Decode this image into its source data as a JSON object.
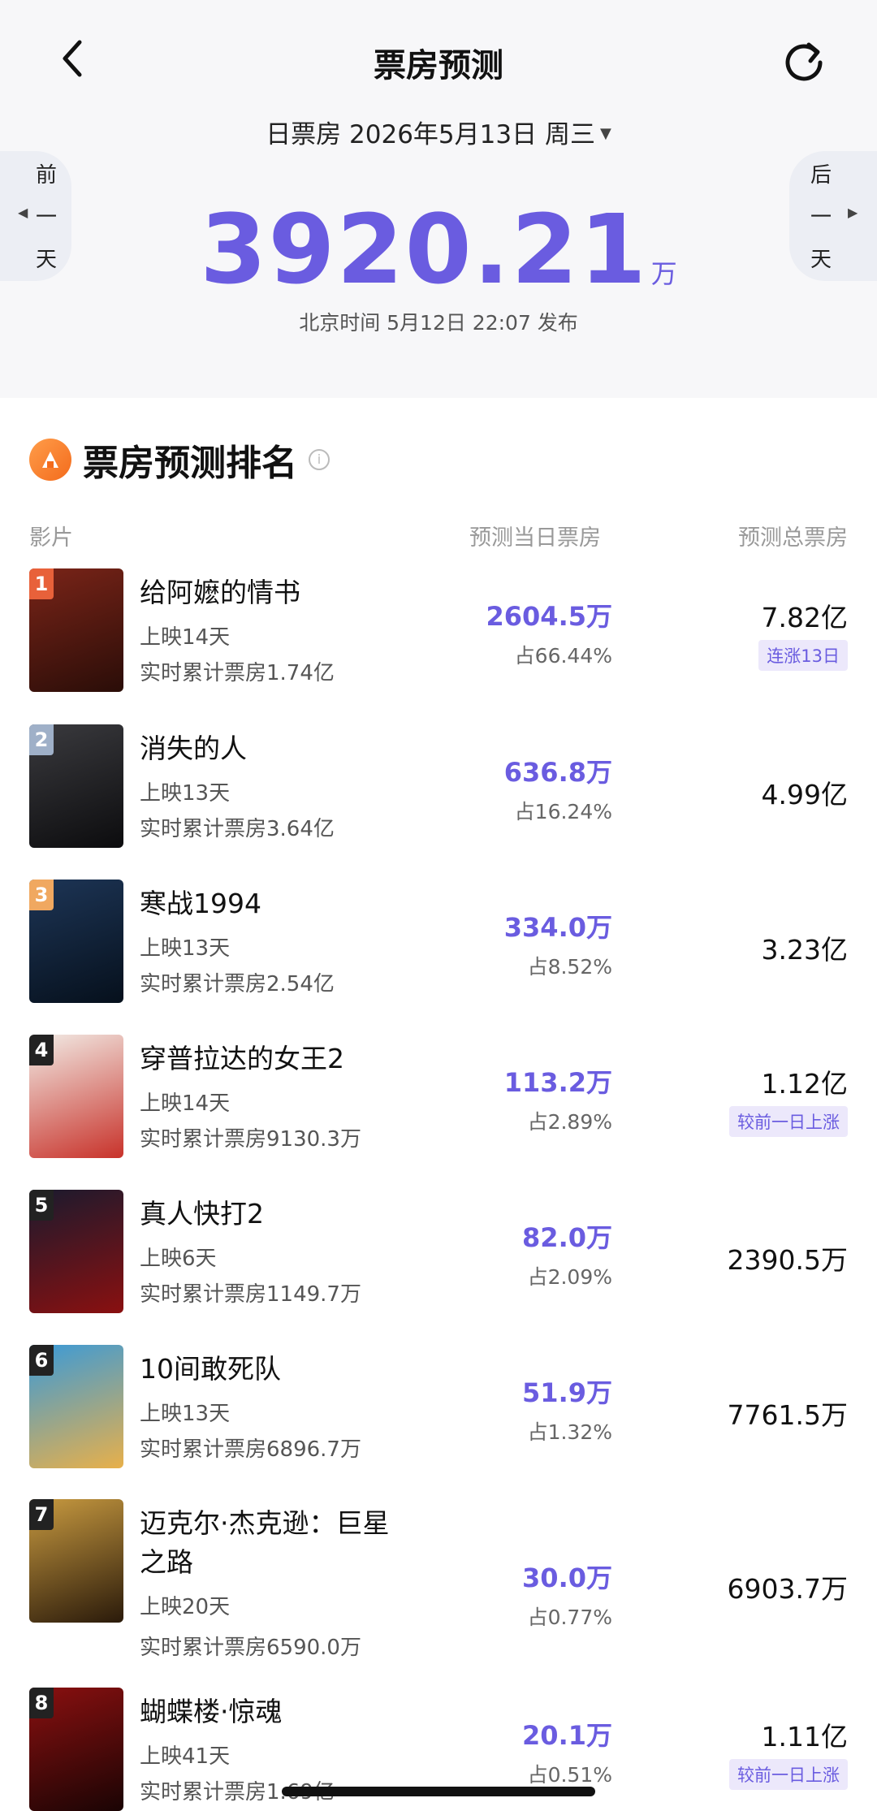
{
  "header": {
    "title": "票房预测",
    "date_label": "日票房 2026年5月13日 周三",
    "prev_label": "前一天",
    "next_label": "后一天",
    "total_value": "3920.21",
    "total_unit": "万",
    "published": "北京时间 5月12日 22:07 发布"
  },
  "section": {
    "title": "票房预测排名",
    "col_film": "影片",
    "col_daily": "预测当日票房",
    "col_total": "预测总票房"
  },
  "movies": [
    {
      "rank": "1",
      "name": "给阿嬷的情书",
      "days": "上映14天",
      "cumulative": "实时累计票房1.74亿",
      "daily": "2604.5万",
      "share": "占66.44%",
      "total": "7.82亿",
      "tag": "连涨13日",
      "rank_color": "#e8613a",
      "poster": [
        "#7a2418",
        "#2a0d08"
      ]
    },
    {
      "rank": "2",
      "name": "消失的人",
      "days": "上映13天",
      "cumulative": "实时累计票房3.64亿",
      "daily": "636.8万",
      "share": "占16.24%",
      "total": "4.99亿",
      "tag": "",
      "rank_color": "#9fb0c8",
      "poster": [
        "#3a3a3e",
        "#0c0c0e"
      ]
    },
    {
      "rank": "3",
      "name": "寒战1994",
      "days": "上映13天",
      "cumulative": "实时累计票房2.54亿",
      "daily": "334.0万",
      "share": "占8.52%",
      "total": "3.23亿",
      "tag": "",
      "rank_color": "#f0a860",
      "poster": [
        "#1d3556",
        "#06101c"
      ]
    },
    {
      "rank": "4",
      "name": "穿普拉达的女王2",
      "days": "上映14天",
      "cumulative": "实时累计票房9130.3万",
      "daily": "113.2万",
      "share": "占2.89%",
      "total": "1.12亿",
      "tag": "较前一日上涨",
      "rank_color": "#222222",
      "poster": [
        "#f2ece6",
        "#c8322a"
      ]
    },
    {
      "rank": "5",
      "name": "真人快打2",
      "days": "上映6天",
      "cumulative": "实时累计票房1149.7万",
      "daily": "82.0万",
      "share": "占2.09%",
      "total": "2390.5万",
      "tag": "",
      "rank_color": "#222222",
      "poster": [
        "#1a1a2e",
        "#8a1010"
      ]
    },
    {
      "rank": "6",
      "name": "10间敢死队",
      "days": "上映13天",
      "cumulative": "实时累计票房6896.7万",
      "daily": "51.9万",
      "share": "占1.32%",
      "total": "7761.5万",
      "tag": "",
      "rank_color": "#222222",
      "poster": [
        "#3a9ad8",
        "#e8b04a"
      ]
    },
    {
      "rank": "7",
      "name": "迈克尔·杰克逊：巨星之路",
      "days": "上映20天",
      "cumulative": "实时累计票房6590.0万",
      "daily": "30.0万",
      "share": "占0.77%",
      "total": "6903.7万",
      "tag": "",
      "rank_color": "#222222",
      "poster": [
        "#c89a40",
        "#2a1a0a"
      ]
    },
    {
      "rank": "8",
      "name": "蝴蝶楼·惊魂",
      "days": "上映41天",
      "cumulative": "实时累计票房1.69亿",
      "daily": "20.1万",
      "share": "占0.51%",
      "total": "1.11亿",
      "tag": "较前一日上涨",
      "rank_color": "#222222",
      "poster": [
        "#8a1010",
        "#1a0404"
      ]
    }
  ]
}
